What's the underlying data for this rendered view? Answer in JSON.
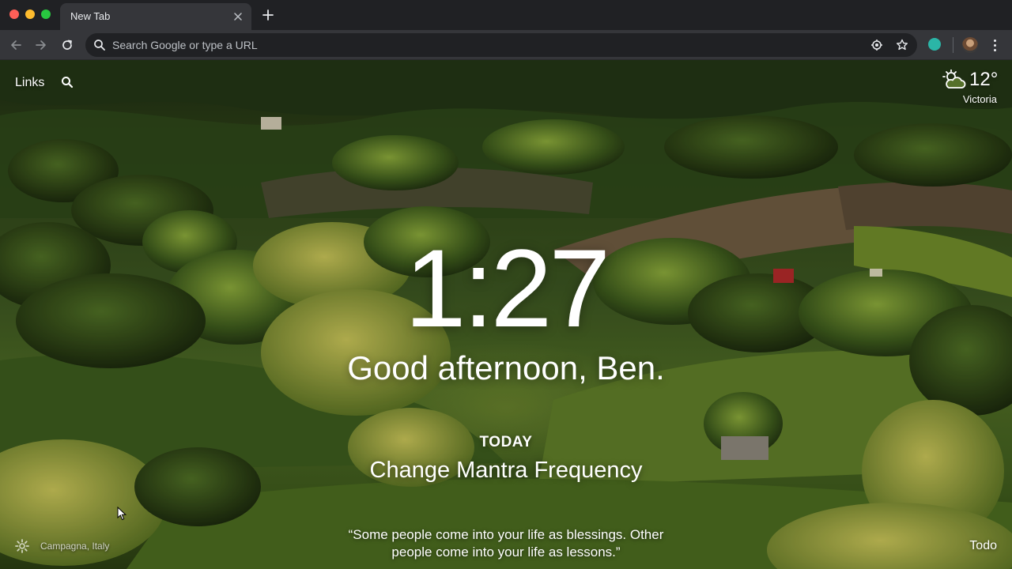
{
  "browser": {
    "tab_title": "New Tab",
    "omnibox_placeholder": "Search Google or type a URL"
  },
  "dashboard": {
    "links_label": "Links",
    "weather": {
      "temperature": "12°",
      "location": "Victoria",
      "icon": "partly-cloudy-icon"
    },
    "clock": "1:27",
    "greeting": "Good afternoon, Ben.",
    "focus": {
      "label": "TODAY",
      "text": "Change Mantra Frequency"
    },
    "quote": "“Some people come into your life as blessings. Other people come into your life as lessons.”",
    "background_location": "Campagna, Italy",
    "todo_label": "Todo"
  },
  "colors": {
    "tab_strip": "#202124",
    "toolbar": "#35363a",
    "extension_accent": "#2bb5a7"
  }
}
